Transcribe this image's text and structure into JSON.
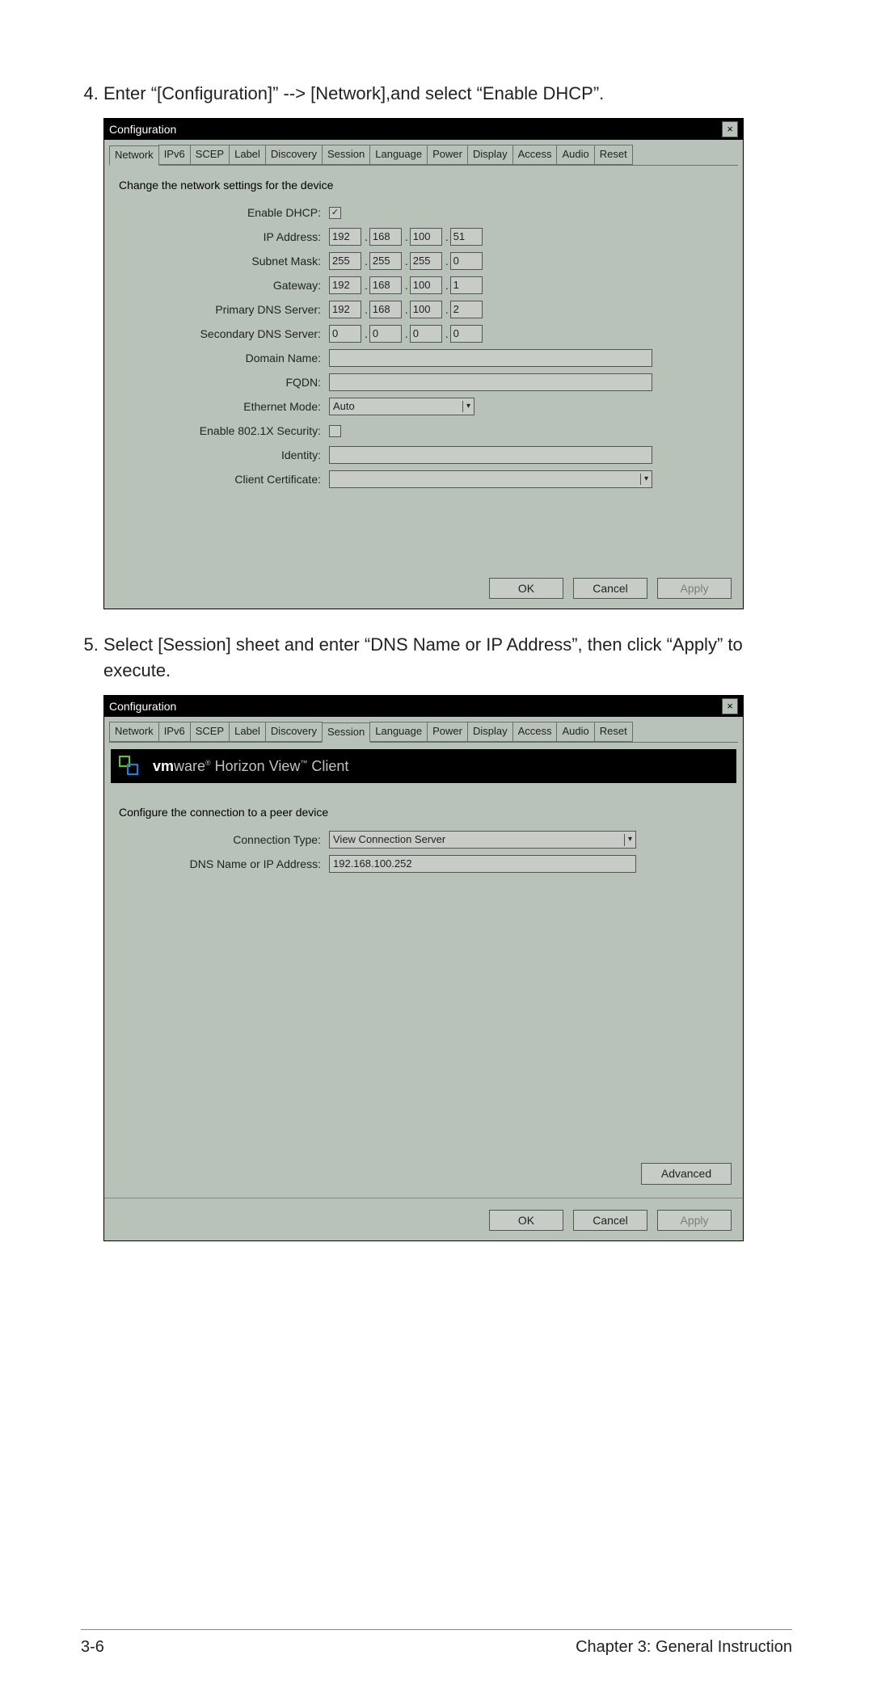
{
  "steps": {
    "s4": "Enter “[Configuration]” --> [Network],and  select “Enable DHCP”.",
    "s5": "Select [Session] sheet and enter “DNS Name or IP Address”, then click “Apply” to execute."
  },
  "window1": {
    "title": "Configuration",
    "close": "×",
    "tabs": [
      "Network",
      "IPv6",
      "SCEP",
      "Label",
      "Discovery",
      "Session",
      "Language",
      "Power",
      "Display",
      "Access",
      "Audio",
      "Reset"
    ],
    "active_tab_index": 0,
    "section_label": "Change the network settings for the device",
    "labels": {
      "enable_dhcp": "Enable DHCP:",
      "ip_address": "IP Address:",
      "subnet_mask": "Subnet Mask:",
      "gateway": "Gateway:",
      "primary_dns": "Primary DNS Server:",
      "secondary_dns": "Secondary DNS Server:",
      "domain_name": "Domain Name:",
      "fqdn": "FQDN:",
      "ethernet_mode": "Ethernet Mode:",
      "enable_8021x": "Enable 802.1X Security:",
      "identity": "Identity:",
      "client_cert": "Client Certificate:"
    },
    "values": {
      "enable_dhcp_checked": true,
      "ip": [
        "192",
        "168",
        "100",
        "51"
      ],
      "subnet": [
        "255",
        "255",
        "255",
        "0"
      ],
      "gateway": [
        "192",
        "168",
        "100",
        "1"
      ],
      "primary_dns": [
        "192",
        "168",
        "100",
        "2"
      ],
      "secondary_dns": [
        "0",
        "0",
        "0",
        "0"
      ],
      "domain_name": "",
      "fqdn": "",
      "ethernet_mode": "Auto",
      "enable_8021x_checked": false,
      "identity": "",
      "client_cert": ""
    },
    "buttons": {
      "ok": "OK",
      "cancel": "Cancel",
      "apply": "Apply"
    }
  },
  "window2": {
    "title": "Configuration",
    "close": "×",
    "tabs": [
      "Network",
      "IPv6",
      "SCEP",
      "Label",
      "Discovery",
      "Session",
      "Language",
      "Power",
      "Display",
      "Access",
      "Audio",
      "Reset"
    ],
    "active_tab_index": 5,
    "banner_brand_bold": "vm",
    "banner_brand_light": "ware",
    "banner_rest": " Horizon View",
    "banner_client": " Client",
    "banner_tm": "™",
    "section_label": "Configure the connection to a peer device",
    "labels": {
      "conn_type": "Connection Type:",
      "dns_name": "DNS Name or IP Address:"
    },
    "values": {
      "conn_type": "View Connection Server",
      "dns_name": "192.168.100.252"
    },
    "advanced": "Advanced",
    "buttons": {
      "ok": "OK",
      "cancel": "Cancel",
      "apply": "Apply"
    }
  },
  "footer": {
    "left": "3-6",
    "right": "Chapter 3: General Instruction"
  }
}
